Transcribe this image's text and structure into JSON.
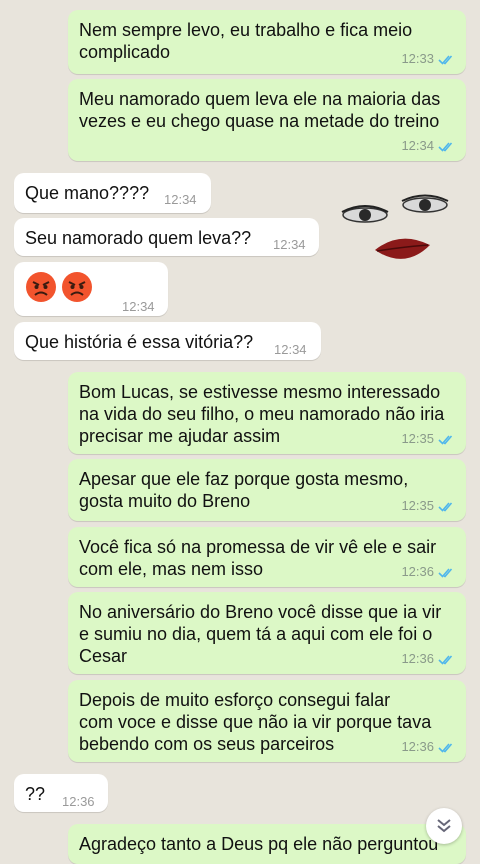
{
  "messages": [
    {
      "text": "Nem sempre levo, eu trabalho e fica meio\ncomplicado",
      "time": "12:33"
    },
    {
      "text": "Meu namorado quem leva ele na maioria das\nvezes e eu chego quase na metade do treino",
      "time": "12:34"
    },
    {
      "text": "Que mano????",
      "time": "12:34"
    },
    {
      "text": "Seu namorado quem leva??",
      "time": "12:34"
    },
    {
      "time": "12:34"
    },
    {
      "text": "Que história é essa vitória??",
      "time": "12:34"
    },
    {
      "text": "Bom Lucas, se estivesse mesmo interessado\nna vida do seu filho, o meu namorado não iria\nprecisar me ajudar assim",
      "time": "12:35"
    },
    {
      "text": "Apesar que ele faz porque gosta mesmo,\ngosta muito do Breno",
      "time": "12:35"
    },
    {
      "text": "Você fica só na promessa de vir vê ele e sair\ncom ele, mas nem isso",
      "time": "12:36"
    },
    {
      "text": "No aniversário do Breno você disse que ia vir\ne sumiu no dia, quem tá a aqui com ele foi o\nCesar",
      "time": "12:36"
    },
    {
      "text": "Depois de muito esforço consegui falar\ncom voce e disse que não ia vir porque tava\nbebendo com os seus parceiros",
      "time": "12:36"
    },
    {
      "text": "??",
      "time": "12:36"
    },
    {
      "text": "Agradeço tanto a Deus pq ele não perguntou"
    }
  ],
  "icons": {
    "read_ticks": "double-check-icon",
    "angry_emoji": "angry-face-icon",
    "scroll_down": "double-chevron-down-icon",
    "sticker": "face-sticker"
  },
  "colors": {
    "outgoing": "#dcf8c6",
    "incoming": "#ffffff",
    "background": "#e8e4dc",
    "tick_blue": "#4fb6ec"
  }
}
